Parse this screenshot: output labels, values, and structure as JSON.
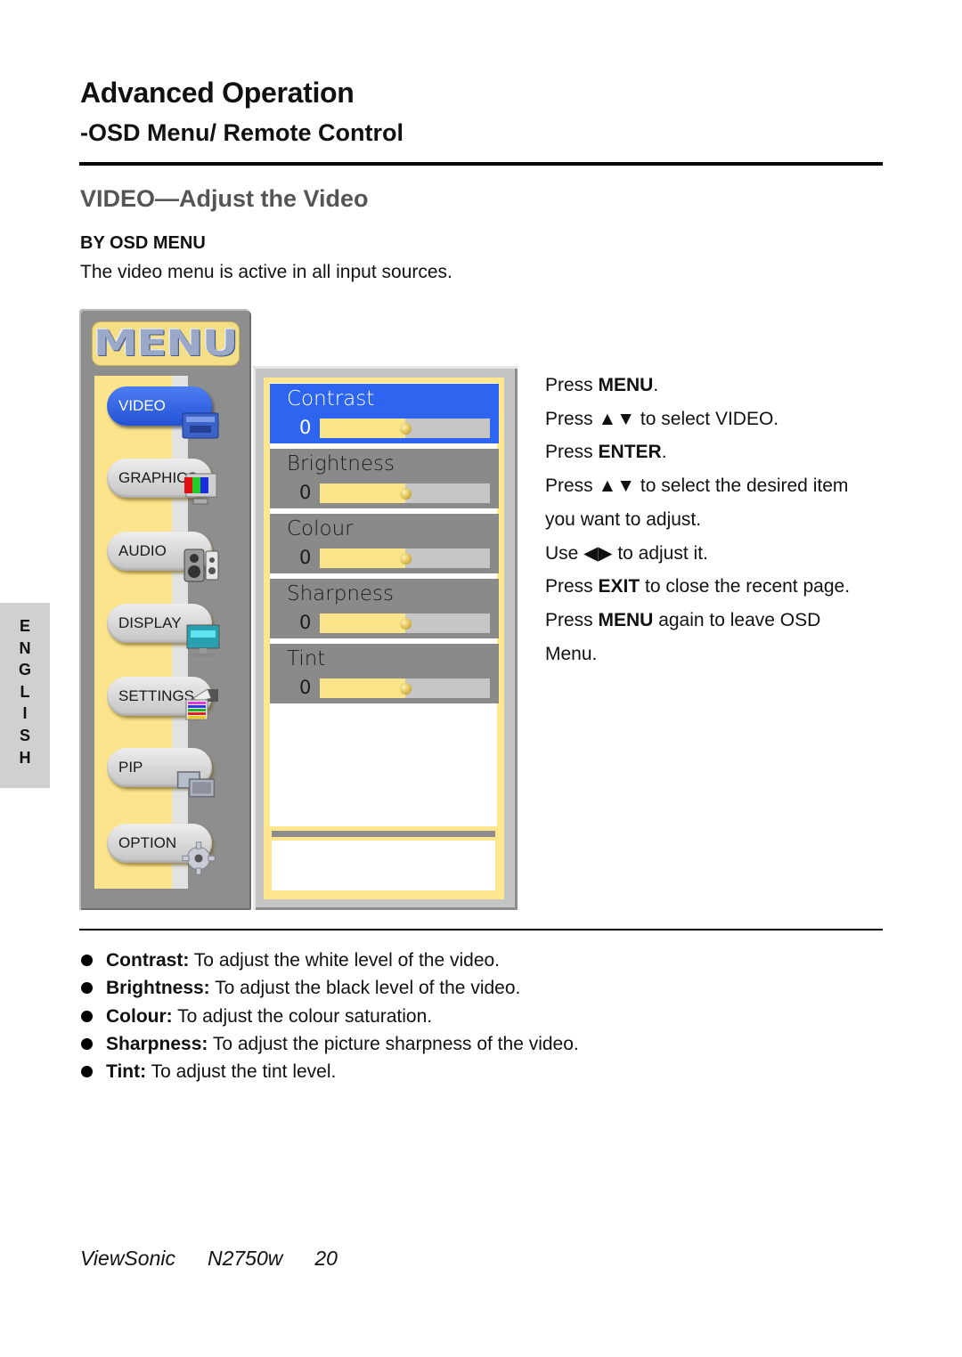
{
  "page": {
    "title": "Advanced Operation",
    "subtitle": "-OSD Menu/ Remote Control",
    "section_title": "VIDEO—Adjust the Video",
    "subsection": "BY OSD MENU",
    "intro": "The video menu is active in all input sources."
  },
  "language_tab": [
    "E",
    "N",
    "G",
    "L",
    "I",
    "S",
    "H"
  ],
  "osd": {
    "menu_title": "MENU",
    "menu_items": [
      {
        "label": "VIDEO",
        "icon": "video-icon",
        "active": true
      },
      {
        "label": "GRAPHICS",
        "icon": "monitor-rgb-icon",
        "active": false
      },
      {
        "label": "AUDIO",
        "icon": "speaker-icon",
        "active": false
      },
      {
        "label": "DISPLAY",
        "icon": "display-icon",
        "active": false
      },
      {
        "label": "SETTINGS",
        "icon": "settings-hand-icon",
        "active": false
      },
      {
        "label": "PIP",
        "icon": "pip-icon",
        "active": false
      },
      {
        "label": "OPTION",
        "icon": "gear-icon",
        "active": false
      }
    ],
    "sub_items": [
      {
        "label": "Contrast",
        "value": "0",
        "level": 0.5,
        "active": true
      },
      {
        "label": "Brightness",
        "value": "0",
        "level": 0.5,
        "active": false
      },
      {
        "label": "Colour",
        "value": "0",
        "level": 0.5,
        "active": false
      },
      {
        "label": "Sharpness",
        "value": "0",
        "level": 0.5,
        "active": false
      },
      {
        "label": "Tint",
        "value": "0",
        "level": 0.5,
        "active": false
      }
    ],
    "colors": {
      "active": "#2d64f0",
      "inactive": "#8a8a8a",
      "frame_yellow": "#fde68d"
    }
  },
  "instructions": [
    {
      "pre": "Press ",
      "bold": "MENU",
      "post": "."
    },
    {
      "pre": "Press ▲▼ to select VIDEO.",
      "bold": "",
      "post": ""
    },
    {
      "pre": "Press ",
      "bold": "ENTER",
      "post": "."
    },
    {
      "pre": "Press ▲▼ to select the desired item",
      "bold": "",
      "post": ""
    },
    {
      "pre": "you want to adjust.",
      "bold": "",
      "post": ""
    },
    {
      "pre": "Use ◀▶ to adjust it.",
      "bold": "",
      "post": ""
    },
    {
      "pre": "Press ",
      "bold": "EXIT",
      "post": " to close the recent page."
    },
    {
      "pre": "Press ",
      "bold": "MENU",
      "post": " again to leave OSD"
    },
    {
      "pre": "Menu.",
      "bold": "",
      "post": ""
    }
  ],
  "descriptions": [
    {
      "term": "Contrast:",
      "text": " To adjust the white level of the video."
    },
    {
      "term": "Brightness:",
      "text": " To adjust the black level of the video."
    },
    {
      "term": "Colour:",
      "text": " To adjust the colour saturation."
    },
    {
      "term": "Sharpness:",
      "text": " To adjust the picture sharpness of the video."
    },
    {
      "term": "Tint:",
      "text": " To adjust the tint level."
    }
  ],
  "footer": {
    "brand": "ViewSonic",
    "model": "N2750w",
    "page_number": "20"
  }
}
